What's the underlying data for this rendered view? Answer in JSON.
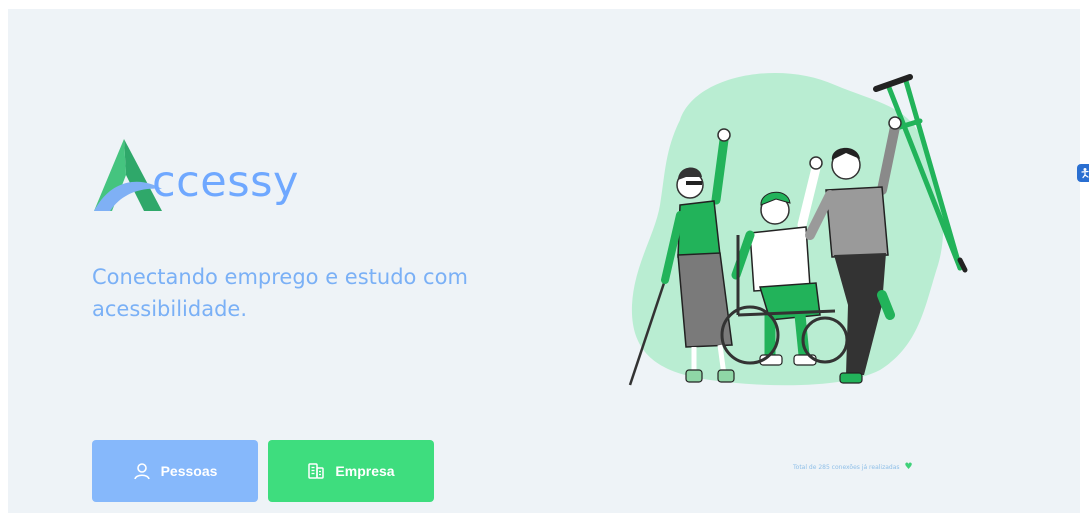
{
  "brand": {
    "name": "ccessy"
  },
  "hero": {
    "tagline": "Conectando emprego e estudo com acessibilidade."
  },
  "actions": {
    "people_label": "Pessoas",
    "company_label": "Empresa"
  },
  "footer": {
    "counter_text": "Total de 285 conexões já realizadas"
  },
  "icons": {
    "people": "user-icon",
    "company": "building-icon",
    "counter": "heart-icon",
    "widget": "accessibility-icon"
  },
  "colors": {
    "background": "#eef3f7",
    "brand_blue": "#6fa8ff",
    "people_button": "#86b8fb",
    "company_button": "#3edd7e",
    "illustration_green": "#b9edd2",
    "accent_green": "#22b35a"
  }
}
